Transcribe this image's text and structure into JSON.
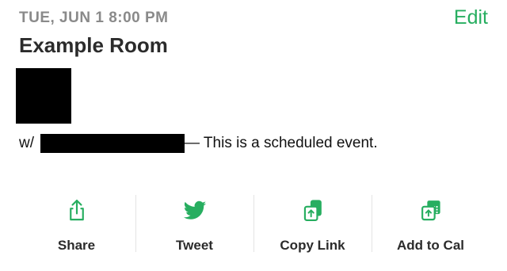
{
  "event": {
    "datetime": "TUE, JUN 1 8:00 PM",
    "edit_label": "Edit",
    "room_name": "Example Room",
    "with_prefix": "w/",
    "description": "— This is a scheduled event."
  },
  "actions": [
    {
      "label": "Share",
      "icon": "share-icon"
    },
    {
      "label": "Tweet",
      "icon": "twitter-icon"
    },
    {
      "label": "Copy Link",
      "icon": "copy-link-icon"
    },
    {
      "label": "Add to Cal",
      "icon": "add-to-calendar-icon"
    }
  ],
  "colors": {
    "accent": "#27ae60",
    "muted_text": "#8a8a8a",
    "text": "#2b2b2b",
    "divider": "#e3e3e3"
  }
}
